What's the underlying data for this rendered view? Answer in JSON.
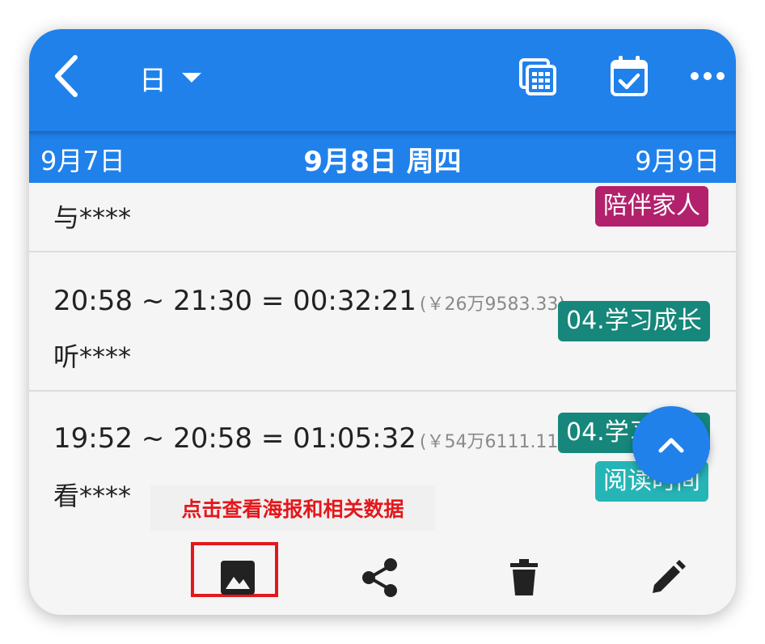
{
  "header": {
    "view_mode": "日",
    "icons": [
      "back-icon",
      "dropdown-caret-icon",
      "calendar-grid-icon",
      "calendar-check-icon",
      "more-icon"
    ]
  },
  "date_nav": {
    "prev": "9月7日",
    "current": "9月8日 周四",
    "next": "9月9日"
  },
  "records": [
    {
      "desc": "与****",
      "tags": [
        "陪伴家人"
      ]
    },
    {
      "time": "20:58 ~ 21:30 = 00:32:21",
      "money": "(￥26万9583.33)",
      "desc": "听****",
      "tags": [
        "04.学习成长"
      ]
    },
    {
      "time": "19:52 ~ 20:58 = 01:05:32",
      "money": "(￥54万6111.11)",
      "desc": "看****",
      "tags": [
        "04.学习成长",
        "阅读时间"
      ]
    }
  ],
  "hint": "点击查看海报和相关数据",
  "actions": [
    "poster-icon",
    "share-icon",
    "delete-icon",
    "edit-icon"
  ],
  "colors": {
    "primary": "#2081eb",
    "tag_family": "#b2216c",
    "tag_learning": "#16877a",
    "tag_reading": "#26b5b7",
    "highlight": "#e3181c"
  }
}
